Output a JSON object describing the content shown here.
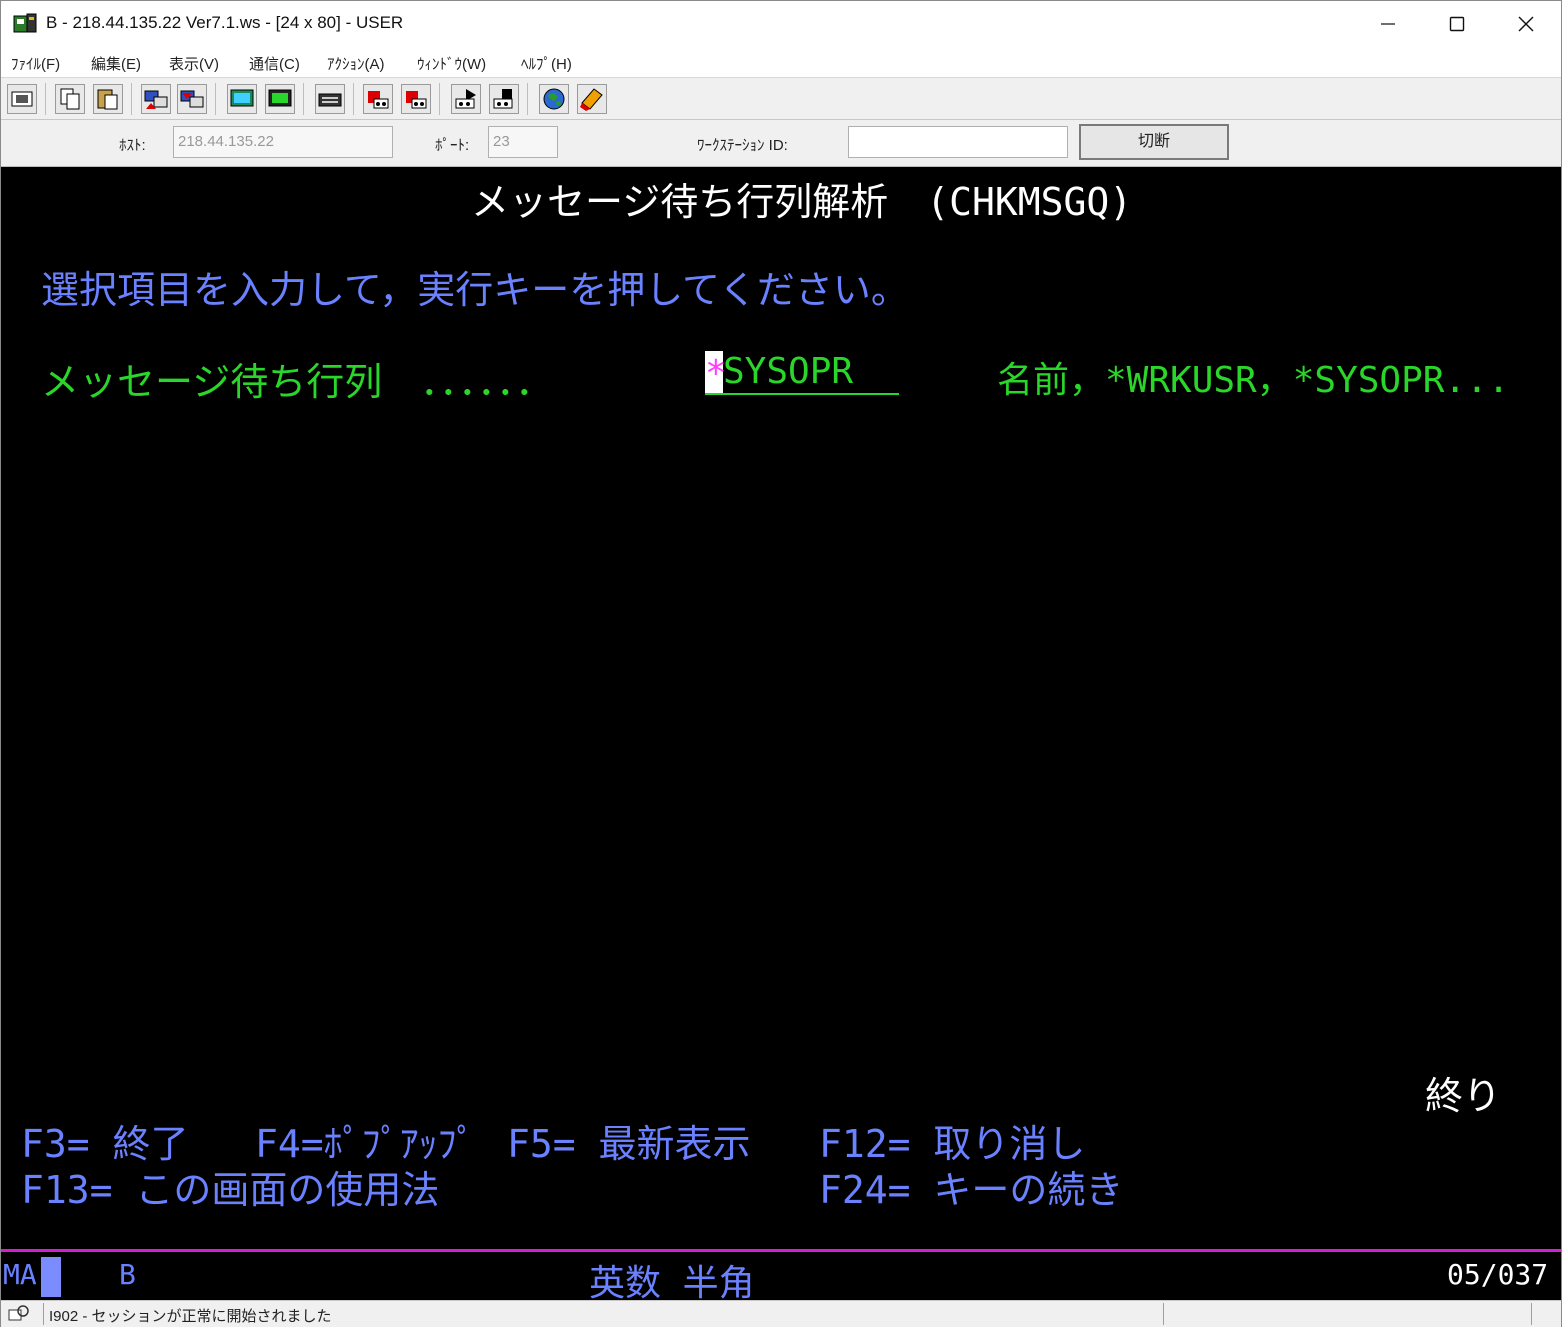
{
  "window": {
    "title": "B - 218.44.135.22 Ver7.1.ws - [24 x 80] - USER"
  },
  "menu": [
    "ﾌｧｲﾙ(F)",
    "編集(E)",
    "表示(V)",
    "通信(C)",
    "ｱｸｼｮﾝ(A)",
    "ｳｨﾝﾄﾞｳ(W)",
    "ﾍﾙﾌﾟ(H)"
  ],
  "connection": {
    "host_label": "ﾎｽﾄ:",
    "host_value": "218.44.135.22",
    "port_label": "ﾎﾟｰﾄ:",
    "port_value": "23",
    "workstation_label": "ﾜｰｸｽﾃｰｼｮﾝ ID:",
    "workstation_value": "",
    "disconnect_label": "切断"
  },
  "screen": {
    "title": "メッセージ待ち行列解析　(CHKMSGQ)",
    "instruction": "選択項目を入力して，実行キーを押してください。",
    "field_label": "メッセージ待ち行列　．．．．．．",
    "field_value_first": "*",
    "field_value_rest": "SYSOPR",
    "field_hint": "名前，*WRKUSR，*SYSOPR...",
    "end_marker": "終り",
    "fkeys": {
      "f3": "F3= 終了",
      "f4": "F4=ﾎﾟﾌﾟｱｯﾌﾟ",
      "f5": "F5= 最新表示",
      "f12": "F12= 取り消し",
      "f13": "F13= この画面の使用法",
      "f24": "F24= キーの続き"
    }
  },
  "status": {
    "mode": "MA",
    "session": "B",
    "input_mode": "英数 半角",
    "cursor_pos": "05/037",
    "message": "I902 - セッションが正常に開始されました"
  },
  "icons": [
    "app-icon",
    "minimize-icon",
    "maximize-icon",
    "close-icon",
    "print-screen-icon",
    "copy-icon",
    "paste-icon",
    "send-file-icon",
    "receive-file-icon",
    "display-icon",
    "keyboard-icon",
    "macro-icon",
    "record-icon",
    "play-icon",
    "stop-icon",
    "web-icon",
    "help-icon",
    "status-icon"
  ],
  "colors": {
    "terminal_bg": "#000000",
    "title_text": "#ffffff",
    "instruction_text": "#6a82ff",
    "field_text": "#2ad62a",
    "cursor_highlight": "#ff3cff",
    "status_line": "#d11fd1"
  }
}
